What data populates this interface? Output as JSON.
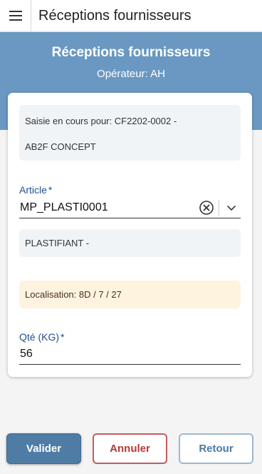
{
  "topbar": {
    "menu_icon": "hamburger-menu-icon",
    "title": "Réceptions fournisseurs"
  },
  "hero": {
    "title": "Réceptions fournisseurs",
    "operator": "Opérateur: AH"
  },
  "form": {
    "info_line1": "Saisie en cours pour: CF2202-0002 -",
    "info_line2": "AB2F CONCEPT",
    "article_label": "Article",
    "article_required": "*",
    "article_value": "MP_PLASTI0001",
    "article_description": "PLASTIFIANT -",
    "location": "Localisation: 8D / 7 / 27",
    "qty_label": "Qté (KG)",
    "qty_required": "*",
    "qty_value": "56"
  },
  "actions": {
    "validate_label": "Valider",
    "cancel_label": "Annuler",
    "back_label": "Retour"
  },
  "colors": {
    "header_blue": "#6a98c2",
    "primary_button": "#4e7ca4",
    "cancel_red": "#b23a3a",
    "location_bg": "#fdf3df",
    "info_bg": "#f0f4f7",
    "label_blue": "#1f4f8a"
  }
}
